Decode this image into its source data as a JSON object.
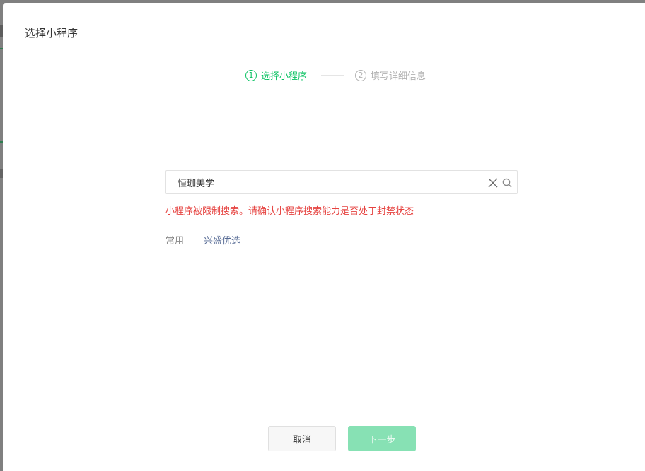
{
  "dialog": {
    "title": "选择小程序"
  },
  "steps": [
    {
      "num": "1",
      "label": "选择小程序",
      "state": "active"
    },
    {
      "num": "2",
      "label": "填写详细信息",
      "state": "inactive"
    }
  ],
  "search": {
    "value": "恒珈美学",
    "placeholder": ""
  },
  "error_message": "小程序被限制搜索。请确认小程序搜索能力是否处于封禁状态",
  "common": {
    "label": "常用",
    "items": [
      "兴盛优选"
    ]
  },
  "buttons": {
    "cancel": "取消",
    "next": "下一步"
  },
  "colors": {
    "accent": "#07c160",
    "error": "#e64340",
    "link": "#576b95",
    "disabled_primary": "#87e1b4"
  },
  "icons": {
    "clear": "close-icon",
    "search": "search-icon"
  }
}
